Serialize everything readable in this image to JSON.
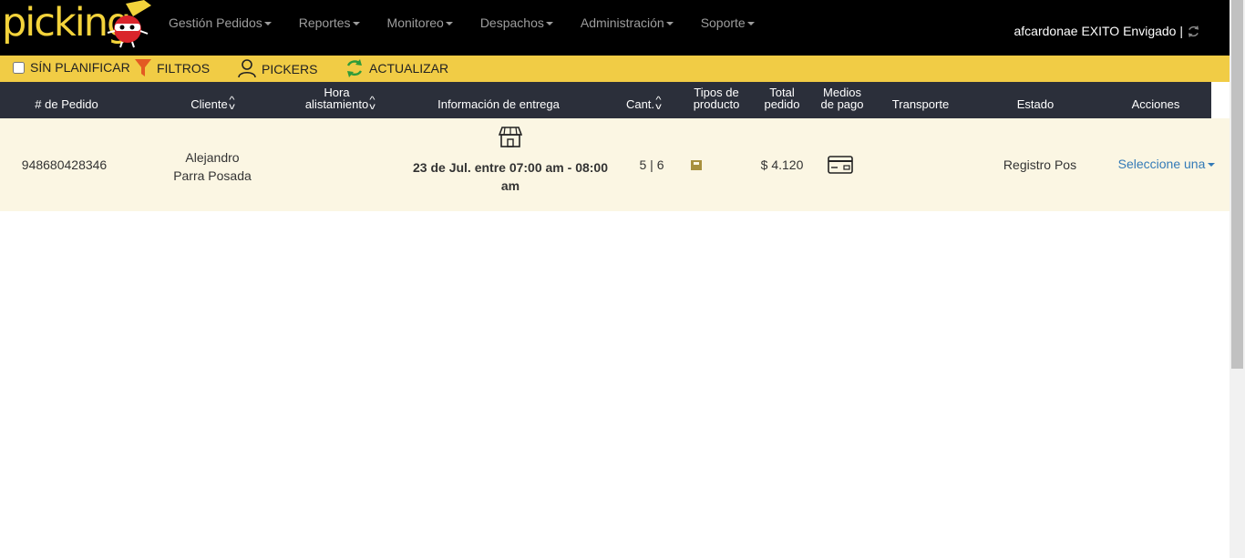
{
  "app": {
    "logo_text": "picking"
  },
  "nav": {
    "items": [
      {
        "label": "Gestión Pedidos"
      },
      {
        "label": "Reportes"
      },
      {
        "label": "Monitoreo"
      },
      {
        "label": "Despachos"
      },
      {
        "label": "Administración"
      },
      {
        "label": "Soporte"
      }
    ],
    "user": "afcardonae EXITO Envigado |"
  },
  "toolbar": {
    "sin_planificar": "SÍN PLANIFICAR",
    "filtros": "FILTROS",
    "pickers": "PICKERS",
    "actualizar": "ACTUALIZAR"
  },
  "table": {
    "headers": {
      "pedido": "# de Pedido",
      "cliente": "Cliente",
      "hora_1": "Hora",
      "hora_2": "alistamiento",
      "entrega": "Información de entrega",
      "cant": "Cant.",
      "tipos_1": "Tipos de",
      "tipos_2": "producto",
      "total_1": "Total",
      "total_2": "pedido",
      "medios_1": "Medios",
      "medios_2": "de pago",
      "transporte": "Transporte",
      "estado": "Estado",
      "acciones": "Acciones"
    },
    "rows": [
      {
        "pedido": "948680428346",
        "cliente_1": "Alejandro",
        "cliente_2": "Parra Posada",
        "entrega_1": "23 de Jul. entre 07:00 am - 08:00",
        "entrega_2": "am",
        "cant": "5 | 6",
        "total": "$ 4.120",
        "estado": "Registro Pos",
        "acciones": "Seleccione una"
      }
    ]
  },
  "colors": {
    "nav_bg": "#000000",
    "toolbar_bg": "#f1cc45",
    "header_bg": "#2b2f3a",
    "row_bg": "#fbf6e3",
    "logo_yellow": "#f3d33b"
  },
  "icons": {
    "logo": "ninja-mascot-icon",
    "filter": "funnel-icon",
    "pickers": "person-icon",
    "refresh": "refresh-icon",
    "store": "store-icon",
    "product": "bag-icon",
    "payment": "credit-card-icon"
  }
}
